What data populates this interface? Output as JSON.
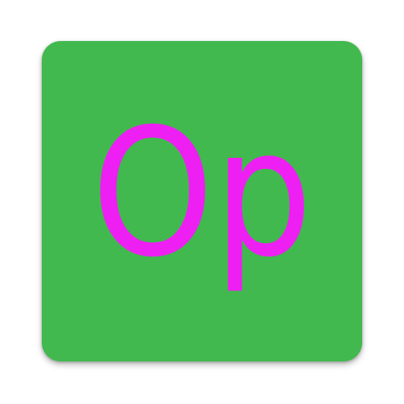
{
  "icon": {
    "label": "Op",
    "background_color": "#41b94e",
    "text_color": "#ee1ff2"
  }
}
